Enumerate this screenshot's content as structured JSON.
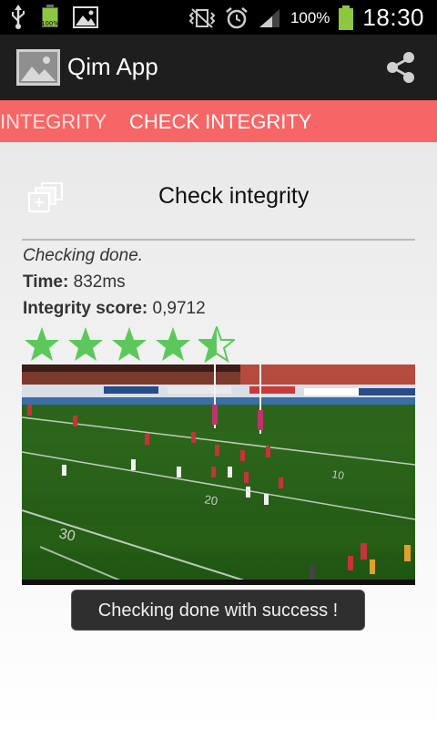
{
  "status_bar": {
    "battery_small_pct": "100%",
    "battery_pct": "100%",
    "time": "18:30",
    "icons_left": [
      "usb-icon",
      "battery-small-icon",
      "gallery-icon"
    ],
    "icons_right": [
      "vibrate-icon",
      "alarm-icon",
      "signal-icon",
      "battery-icon"
    ]
  },
  "action_bar": {
    "app_title": "Qim App",
    "share_icon": "share-icon"
  },
  "tabs": {
    "previous_label": "INTEGRITY",
    "current_label": "CHECK INTEGRITY"
  },
  "check": {
    "title": "Check integrity",
    "status": "Checking done.",
    "time_label": "Time:",
    "time_value": " 832ms",
    "score_label": "Integrity score:",
    "score_value": " 0,9712",
    "rating": {
      "value": 4.5,
      "max": 5,
      "color": "#5cc85c"
    }
  },
  "toast": {
    "message": "Checking done with success !"
  },
  "colors": {
    "accent": "#f76666",
    "star": "#5cc85c"
  }
}
